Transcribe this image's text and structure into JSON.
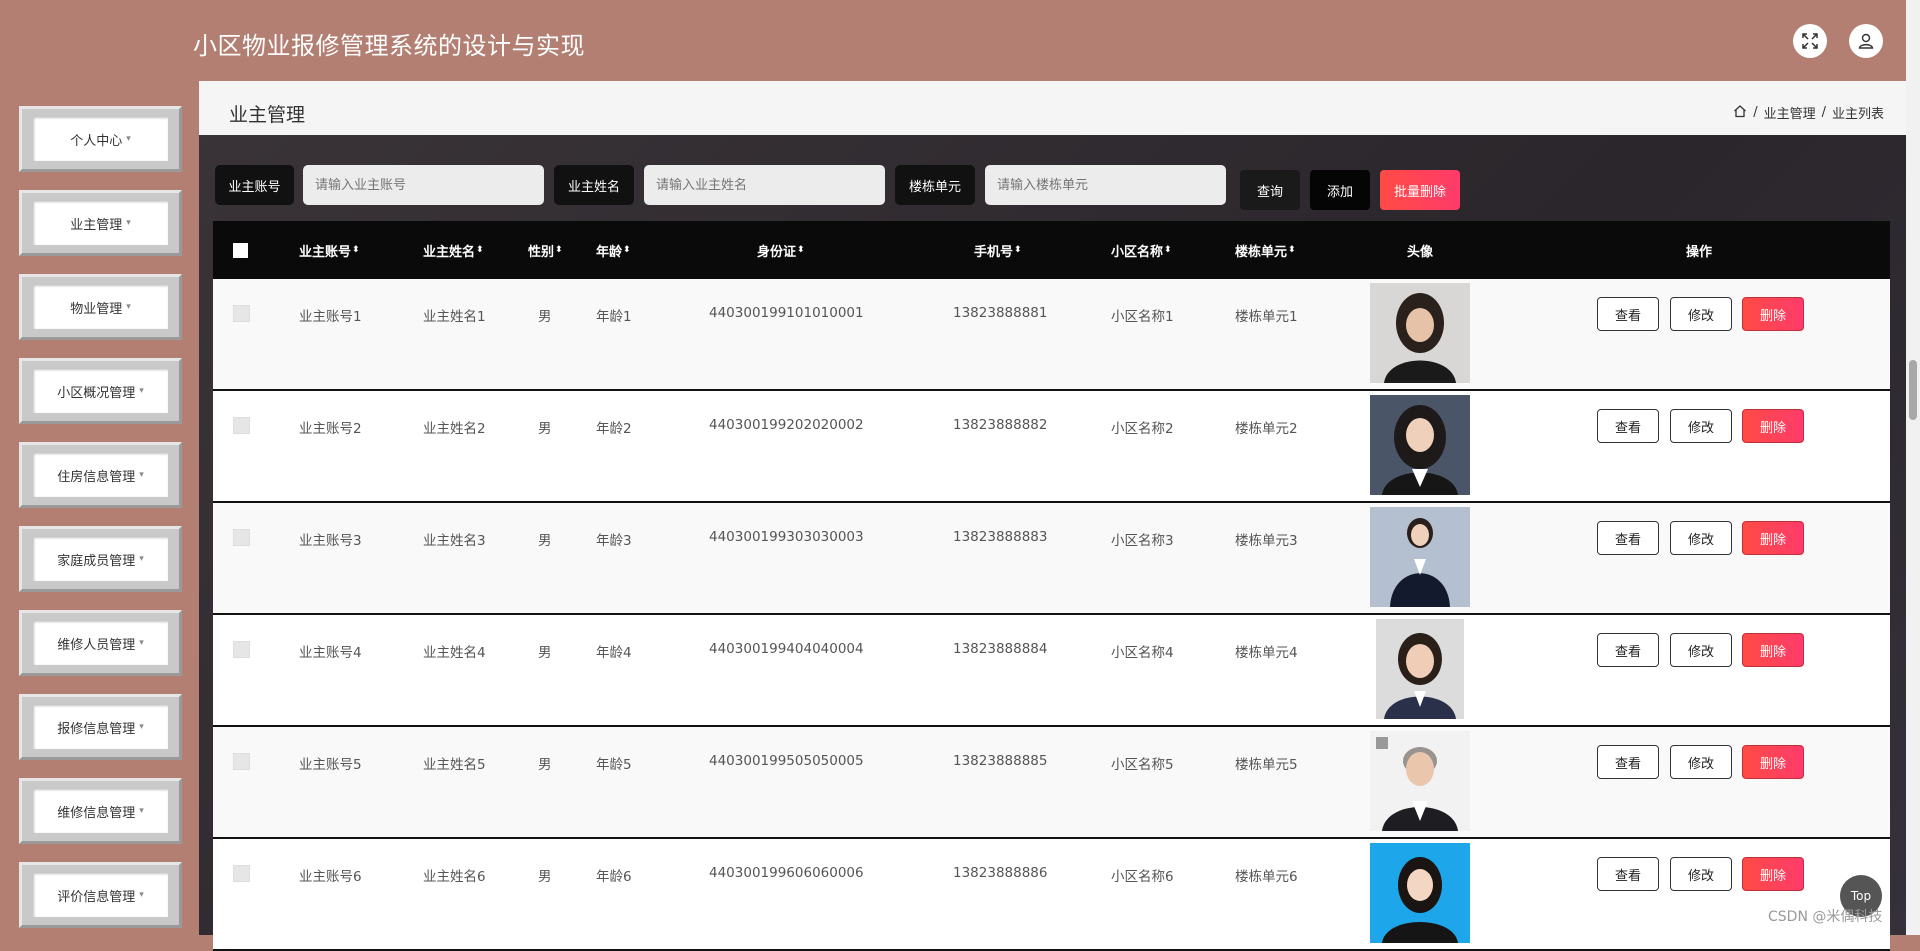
{
  "header": {
    "title": "小区物业报修管理系统的设计与实现",
    "fullscreen_icon": "fullscreen-icon",
    "user_icon": "user-icon"
  },
  "sidebar": {
    "items": [
      {
        "label": "个人中心"
      },
      {
        "label": "业主管理"
      },
      {
        "label": "物业管理"
      },
      {
        "label": "小区概况管理"
      },
      {
        "label": "住房信息管理"
      },
      {
        "label": "家庭成员管理"
      },
      {
        "label": "维修人员管理"
      },
      {
        "label": "报修信息管理"
      },
      {
        "label": "维修信息管理"
      },
      {
        "label": "评价信息管理"
      }
    ],
    "caret": "▾"
  },
  "page": {
    "title": "业主管理",
    "breadcrumb": [
      "业主管理",
      "业主列表"
    ],
    "separator": "/"
  },
  "search": {
    "fields": [
      {
        "label": "业主账号",
        "placeholder": "请输入业主账号"
      },
      {
        "label": "业主姓名",
        "placeholder": "请输入业主姓名"
      },
      {
        "label": "楼栋单元",
        "placeholder": "请输入楼栋单元"
      }
    ],
    "query_label": "查询",
    "add_label": "添加",
    "batch_delete_label": "批量删除"
  },
  "table": {
    "columns": [
      "业主账号",
      "业主姓名",
      "性别",
      "年龄",
      "身份证",
      "手机号",
      "小区名称",
      "楼栋单元",
      "头像",
      "操作"
    ],
    "sort_glyph": "⬍",
    "rows": [
      {
        "account": "业主账号1",
        "name": "业主姓名1",
        "gender": "男",
        "age": "年龄1",
        "id_card": "440300199101010001",
        "phone": "13823888881",
        "community": "小区名称1",
        "unit": "楼栋单元1"
      },
      {
        "account": "业主账号2",
        "name": "业主姓名2",
        "gender": "男",
        "age": "年龄2",
        "id_card": "440300199202020002",
        "phone": "13823888882",
        "community": "小区名称2",
        "unit": "楼栋单元2"
      },
      {
        "account": "业主账号3",
        "name": "业主姓名3",
        "gender": "男",
        "age": "年龄3",
        "id_card": "440300199303030003",
        "phone": "13823888883",
        "community": "小区名称3",
        "unit": "楼栋单元3"
      },
      {
        "account": "业主账号4",
        "name": "业主姓名4",
        "gender": "男",
        "age": "年龄4",
        "id_card": "440300199404040004",
        "phone": "13823888884",
        "community": "小区名称4",
        "unit": "楼栋单元4"
      },
      {
        "account": "业主账号5",
        "name": "业主姓名5",
        "gender": "男",
        "age": "年龄5",
        "id_card": "440300199505050005",
        "phone": "13823888885",
        "community": "小区名称5",
        "unit": "楼栋单元5"
      },
      {
        "account": "业主账号6",
        "name": "业主姓名6",
        "gender": "男",
        "age": "年龄6",
        "id_card": "440300199606060006",
        "phone": "13823888886",
        "community": "小区名称6",
        "unit": "楼栋单元6"
      }
    ],
    "actions": {
      "view": "查看",
      "edit": "修改",
      "delete": "删除"
    }
  },
  "misc": {
    "top_label": "Top",
    "watermark": "CSDN @米偶科技"
  },
  "colors": {
    "brand": "#b37f72",
    "delete": "#ff4b45",
    "header_dark": "#0a0a0a"
  }
}
